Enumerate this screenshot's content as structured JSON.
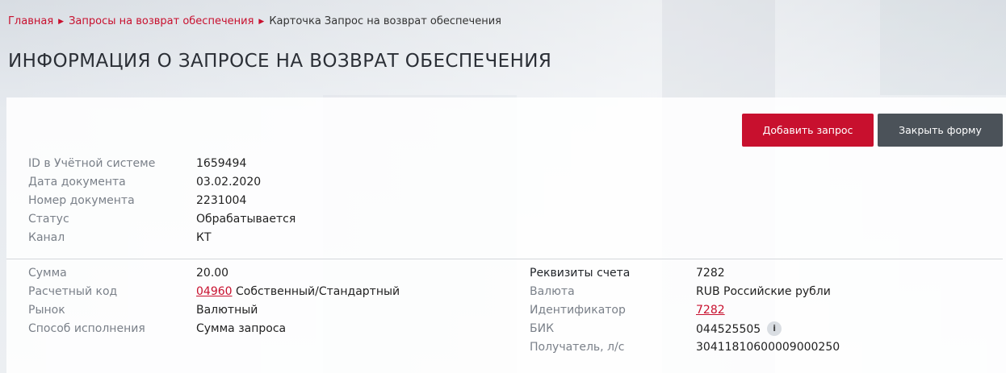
{
  "breadcrumb": {
    "items": [
      "Главная",
      "Запросы на возврат обеспечения"
    ],
    "current": "Карточка Запрос на возврат обеспечения"
  },
  "page": {
    "title": "ИНФОРМАЦИЯ О ЗАПРОСЕ НА ВОЗВРАТ ОБЕСПЕЧЕНИЯ"
  },
  "actions": {
    "add_label": "Добавить запрос",
    "close_label": "Закрыть форму"
  },
  "colors": {
    "accent": "#c8102e",
    "secondary_button": "#4b5259"
  },
  "info_top": {
    "id_label": "ID в Учётной системе",
    "id_value": "1659494",
    "date_label": "Дата документа",
    "date_value": "03.02.2020",
    "doc_label": "Номер документа",
    "doc_value": "2231004",
    "status_label": "Статус",
    "status_value": "Обрабатывается",
    "channel_label": "Канал",
    "channel_value": "КТ"
  },
  "info_left": {
    "sum_label": "Сумма",
    "sum_value": "20.00",
    "code_label": "Расчетный код",
    "code_link": "04960",
    "code_text": "Собственный/Стандартный",
    "market_label": "Рынок",
    "market_value": "Валютный",
    "method_label": "Способ исполнения",
    "method_value": "Сумма запроса"
  },
  "info_right": {
    "req_label": "Реквизиты счета",
    "req_value": "7282",
    "cur_label": "Валюта",
    "cur_value": "RUB Российские рубли",
    "ident_label": "Идентификатор",
    "ident_value": "7282",
    "bik_label": "БИК",
    "bik_value": "044525505",
    "info_icon": "info-icon",
    "info_glyph": "i",
    "recipient_label": "Получатель, л/с",
    "recipient_value": "30411810600009000250"
  }
}
